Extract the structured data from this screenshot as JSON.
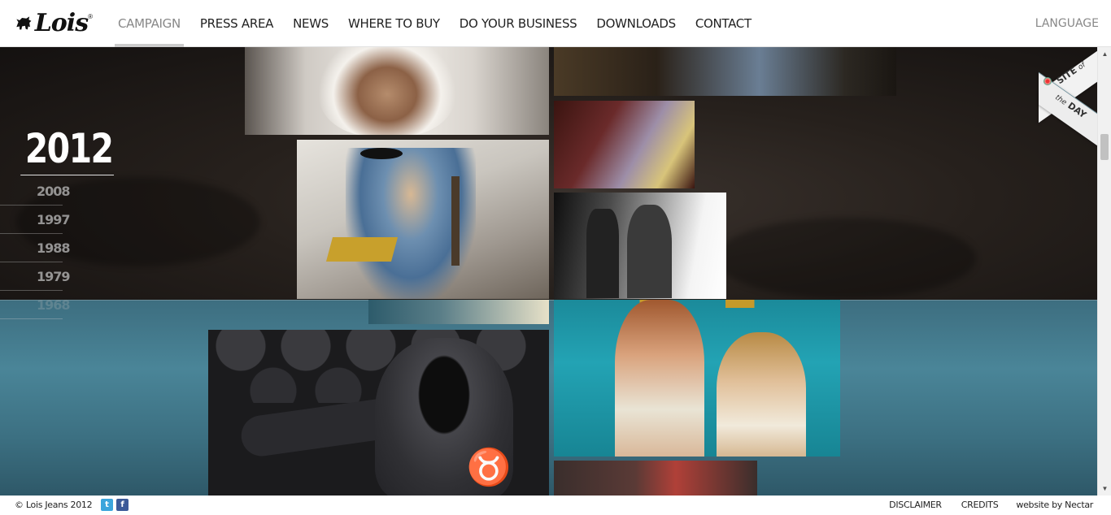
{
  "brand": {
    "logo_text": "Lois",
    "logo_icon": "bull-icon"
  },
  "nav": {
    "items": [
      {
        "label": "CAMPAIGN",
        "active": true
      },
      {
        "label": "PRESS AREA"
      },
      {
        "label": "NEWS"
      },
      {
        "label": "WHERE TO BUY"
      },
      {
        "label": "DO YOUR BUSINESS"
      },
      {
        "label": "DOWNLOADS"
      },
      {
        "label": "CONTACT"
      }
    ],
    "language_label": "LANGUAGE"
  },
  "timeline": {
    "current_year": "2012",
    "years": [
      "2008",
      "1997",
      "1988",
      "1979",
      "1968"
    ]
  },
  "badge": {
    "line1_bold": "SITE",
    "line1_small": "of",
    "line2_small": "the",
    "line2_bold": "DAY"
  },
  "footer": {
    "copyright": "© Lois Jeans 2012",
    "social": [
      {
        "icon": "twitter-icon",
        "glyph": "t"
      },
      {
        "icon": "facebook-icon",
        "glyph": "f"
      }
    ],
    "links": {
      "disclaimer": "DISCLAIMER",
      "credits": "CREDITS",
      "nectar": "website by Nectar"
    }
  },
  "colors": {
    "accent_gold": "#e6c21a",
    "nav_active": "#888888",
    "twitter": "#3ba5dc",
    "facebook": "#3b5998"
  }
}
